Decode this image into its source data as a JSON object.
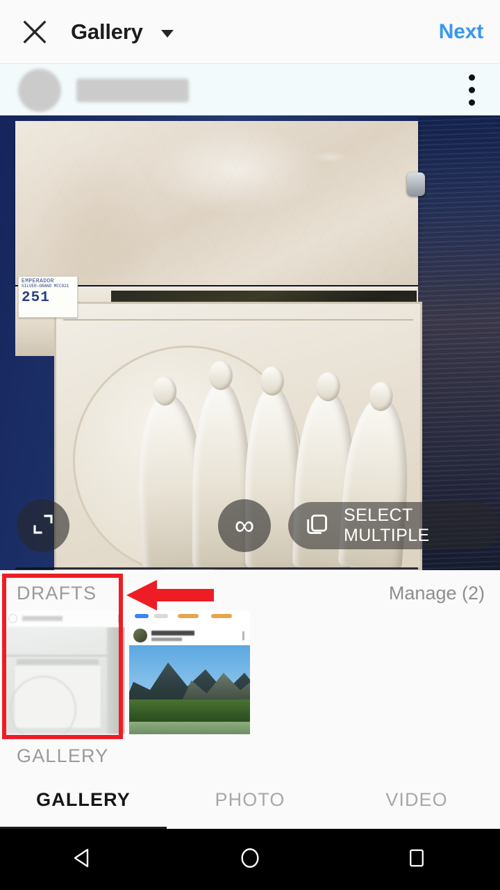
{
  "appbar": {
    "close_icon": "close-icon",
    "title": "Gallery",
    "dropdown_icon": "chevron-down-icon",
    "next_label": "Next",
    "next_color": "#3897f0"
  },
  "user_row": {
    "avatar": "avatar-blurred",
    "username": "",
    "menu_icon": "overflow-menu-icon",
    "background": "#f2fafb"
  },
  "preview": {
    "alt": "marble-slab-relief-photo",
    "tag_line1": "EMPERADOR",
    "tag_line2": "SILVER-GRAND MCC021",
    "tag_number": "251",
    "controls": {
      "expand_icon": "expand-icon",
      "boomerang_icon": "infinity-icon",
      "boomerang_glyph": "∞",
      "select_multiple_icon": "layers-icon",
      "select_multiple_label": "SELECT MULTIPLE"
    }
  },
  "drafts": {
    "title": "DRAFTS",
    "manage_label": "Manage (2)",
    "items": [
      {
        "name": "draft-marble-screenshot",
        "selected": true
      },
      {
        "name": "draft-mountain-screenshot",
        "selected": false
      }
    ]
  },
  "annotation": {
    "box_color": "#ee1c25",
    "arrow_color": "#ee1c25",
    "arrow_direction": "left",
    "target": "drafts-first-thumbnail"
  },
  "gallery": {
    "section_label": "GALLERY"
  },
  "tabs": {
    "items": [
      {
        "label": "GALLERY",
        "active": true
      },
      {
        "label": "PHOTO",
        "active": false
      },
      {
        "label": "VIDEO",
        "active": false
      }
    ],
    "active_color": "#161616",
    "inactive_color": "#a8a8a8"
  },
  "navbar": {
    "back_icon": "back-triangle-icon",
    "home_icon": "home-circle-icon",
    "recents_icon": "recents-square-icon"
  }
}
